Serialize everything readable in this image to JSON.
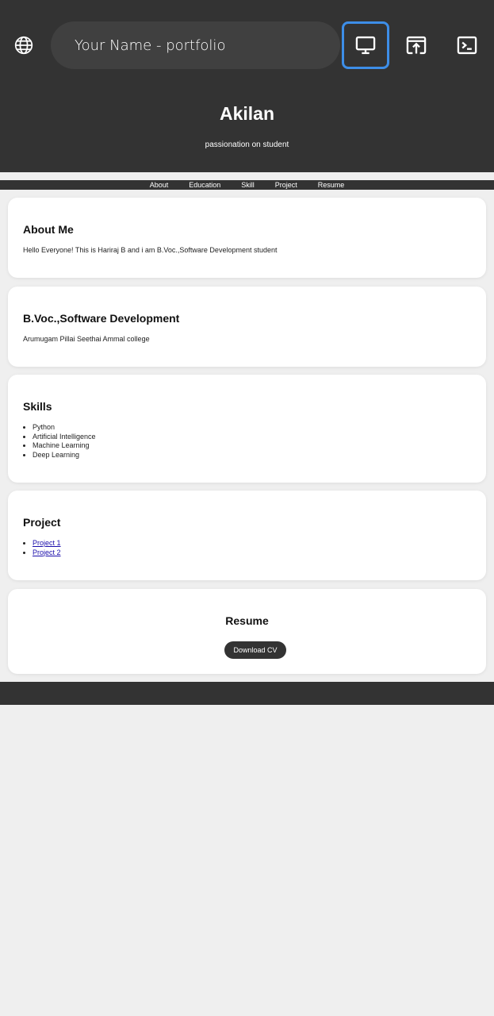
{
  "browser": {
    "url_title": "Your Name - portfolio",
    "icons": {
      "site": "globe-icon",
      "desktop": "desktop-monitor-icon",
      "open_external": "open-in-browser-icon",
      "terminal": "terminal-icon"
    },
    "accent_color": "#3d8ee8"
  },
  "hero": {
    "name": "Akilan",
    "tagline": "passionation on student"
  },
  "nav": {
    "items": [
      "About",
      "Education",
      "Skill",
      "Project",
      "Resume"
    ]
  },
  "about": {
    "heading": "About Me",
    "text": "Hello Everyone! This is Hariraj B and i am B.Voc.,Software Development student"
  },
  "education": {
    "heading": "B.Voc.,Software Development",
    "text": "Arumugam Pillai Seethai Ammal college"
  },
  "skills": {
    "heading": "Skills",
    "items": [
      "Python",
      "Artificial Intelligence",
      "Machine Learning",
      "Deep Learning"
    ]
  },
  "project": {
    "heading": "Project",
    "items": [
      "Project 1",
      "Project 2"
    ]
  },
  "resume": {
    "heading": "Resume",
    "button_label": "Download CV"
  },
  "colors": {
    "header_bg": "#333333",
    "page_bg": "#efefef",
    "card_bg": "#ffffff",
    "link": "#1a0dab"
  }
}
